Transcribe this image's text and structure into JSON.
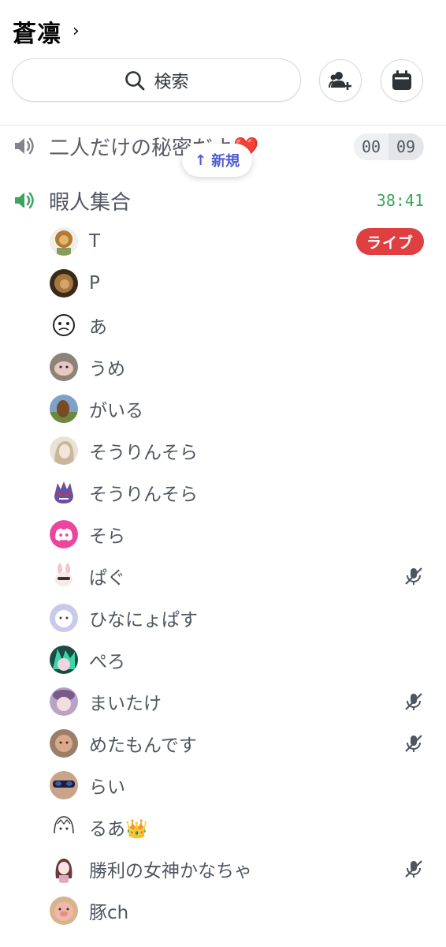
{
  "header": {
    "server_name": "蒼凛",
    "chevron": "›"
  },
  "search": {
    "label": "検索",
    "icon": "search-icon"
  },
  "actions": {
    "invite_icon": "add-member-icon",
    "events_icon": "calendar-icon"
  },
  "channels": [
    {
      "name": "二人だけの秘密だよ❤️",
      "timer_a": "00",
      "timer_b": "09",
      "icon": "speaker-icon"
    },
    {
      "name": "暇人集合",
      "timer": "38:41",
      "icon": "speaker-active-icon"
    }
  ],
  "new_pill": {
    "arrow": "↑",
    "label": "新規"
  },
  "live_badge": "ライブ",
  "members": [
    {
      "name": "T"
    },
    {
      "name": "P"
    },
    {
      "name": "あ"
    },
    {
      "name": "うめ"
    },
    {
      "name": "がいる"
    },
    {
      "name": "そうりんそら"
    },
    {
      "name": "そうりんそら"
    },
    {
      "name": "そら"
    },
    {
      "name": "ぱぐ"
    },
    {
      "name": "ひなにょぱす"
    },
    {
      "name": "ぺろ"
    },
    {
      "name": "まいたけ"
    },
    {
      "name": "めたもんです"
    },
    {
      "name": "らい"
    },
    {
      "name": "るあ👑"
    },
    {
      "name": "勝利の女神かなちゃ"
    },
    {
      "name": "豚ch"
    }
  ],
  "colors": {
    "live": "#e03f42",
    "timer_green": "#3ba55d",
    "new_blue": "#4e5bd6",
    "discord_pink": "#eb459e"
  }
}
